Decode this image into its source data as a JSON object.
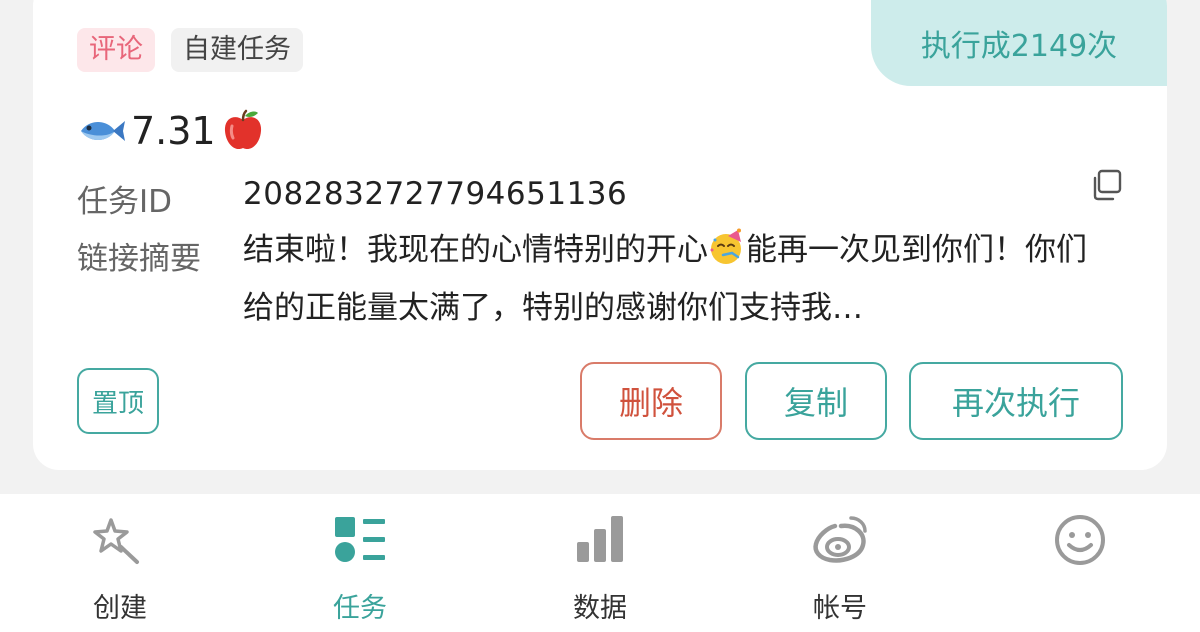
{
  "card": {
    "exec_count": "执行成2149次",
    "tags": [
      "评论",
      "自建任务"
    ],
    "title_text": "7.31",
    "task_id_label": "任务ID",
    "task_id_value": "2082832727794651136",
    "summary_label": "链接摘要",
    "summary_part1": "结束啦！我现在的心情特别的开心",
    "summary_part2": "能再一次见到你们！你们给的正能量太满了，特别的感谢你们支持我…",
    "buttons": {
      "pin": "置顶",
      "delete": "删除",
      "copy": "复制",
      "rerun": "再次执行"
    }
  },
  "tabbar": {
    "items": [
      {
        "label": "创建",
        "icon": "magic-wand-icon",
        "active": false
      },
      {
        "label": "任务",
        "icon": "task-list-icon",
        "active": true
      },
      {
        "label": "数据",
        "icon": "bar-chart-icon",
        "active": false
      },
      {
        "label": "帐号",
        "icon": "weibo-icon",
        "active": false
      },
      {
        "label": "",
        "icon": "smiley-icon",
        "active": false
      }
    ]
  },
  "colors": {
    "accent": "#3aa39b",
    "delete": "#d0523d",
    "comment_tag_bg": "#fde7ea",
    "comment_tag_fg": "#e8667a"
  }
}
